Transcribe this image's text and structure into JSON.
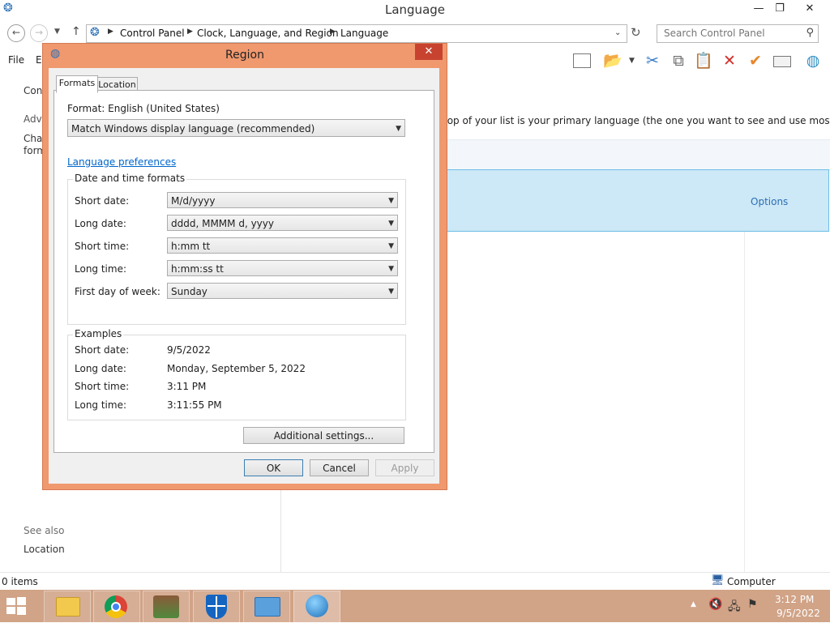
{
  "window": {
    "title": "Language",
    "minimize_glyph": "—",
    "restore_glyph": "❐",
    "close_glyph": "✕"
  },
  "address": {
    "crumbs": [
      "Control Panel",
      "Clock, Language, and Region",
      "Language"
    ],
    "search_placeholder": "Search Control Panel"
  },
  "menu": {
    "file": "File",
    "edit_partial": "E"
  },
  "left_pane": {
    "item1_partial": "Conl",
    "item2_partial": "Adva",
    "item3_line1_partial": "Char",
    "item3_line2_partial": "form",
    "see_also": "See also",
    "location": "Location"
  },
  "content": {
    "description_partial": "top of your list is your primary language (the one you want to see and use most often).",
    "options_link": "Options"
  },
  "statusbar": {
    "items": "0 items",
    "computer": "Computer"
  },
  "taskbar": {
    "time": "3:12 PM",
    "date": "9/5/2022"
  },
  "dialog": {
    "title": "Region",
    "tabs": [
      "Formats",
      "Location"
    ],
    "format_label": "Format: English (United States)",
    "format_value": "Match Windows display language (recommended)",
    "language_prefs_link": "Language preferences",
    "datetime_group": {
      "title": "Date and time formats",
      "rows": [
        {
          "label": "Short date:",
          "value": "M/d/yyyy"
        },
        {
          "label": "Long date:",
          "value": "dddd, MMMM d, yyyy"
        },
        {
          "label": "Short time:",
          "value": "h:mm tt"
        },
        {
          "label": "Long time:",
          "value": "h:mm:ss tt"
        },
        {
          "label": "First day of week:",
          "value": "Sunday"
        }
      ]
    },
    "examples_group": {
      "title": "Examples",
      "rows": [
        {
          "label": "Short date:",
          "value": "9/5/2022"
        },
        {
          "label": "Long date:",
          "value": "Monday, September 5, 2022"
        },
        {
          "label": "Short time:",
          "value": "3:11 PM"
        },
        {
          "label": "Long time:",
          "value": "3:11:55 PM"
        }
      ]
    },
    "additional_settings": "Additional settings...",
    "ok": "OK",
    "cancel": "Cancel",
    "apply": "Apply"
  },
  "colors": {
    "dialog_frame": "#f0986e",
    "taskbar": "#d1a387",
    "selection": "#cde8f6",
    "link": "#0066cc"
  }
}
